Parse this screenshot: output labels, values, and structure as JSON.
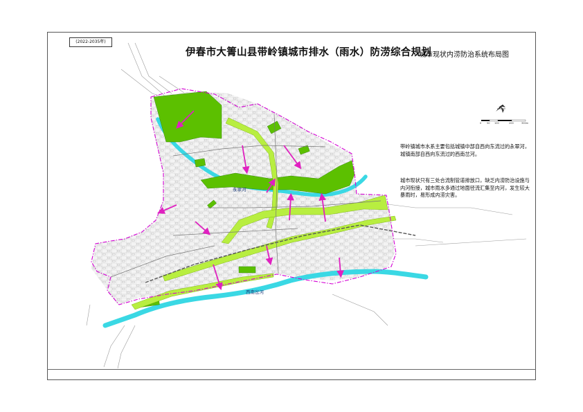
{
  "year_range": "(2022-2035年)",
  "title": "伊春市大箐山县带岭镇城市排水（雨水）防涝综合规划",
  "subtitle": "城市现状内涝防治系统布局图",
  "description": [
    "带岭镇城市水系主要包括城镇中部自西向东流过的永翠河，城镇南部自西向东流过的西南岔河。",
    "城市现状只有三处合流制管道排放口，缺乏内涝防治设施与内河衔接，城市雨水多通过地面径流汇集至内河，发生较大暴雨时，易形成内涝灾害。"
  ],
  "map_labels": {
    "river_north": "永翠河",
    "river_south": "西南岔河"
  },
  "scale_bar": {
    "ticks": [
      "0",
      "50",
      "100",
      "200",
      "300m"
    ]
  },
  "colors": {
    "boundary": "#d400d4",
    "arrow": "#e020c0",
    "river": "#3ad8e4",
    "green_space": "#5cc000",
    "green_corridor": "#b8ee40",
    "road": "#555555"
  },
  "icons": {
    "north_arrow": "north-arrow-icon"
  }
}
